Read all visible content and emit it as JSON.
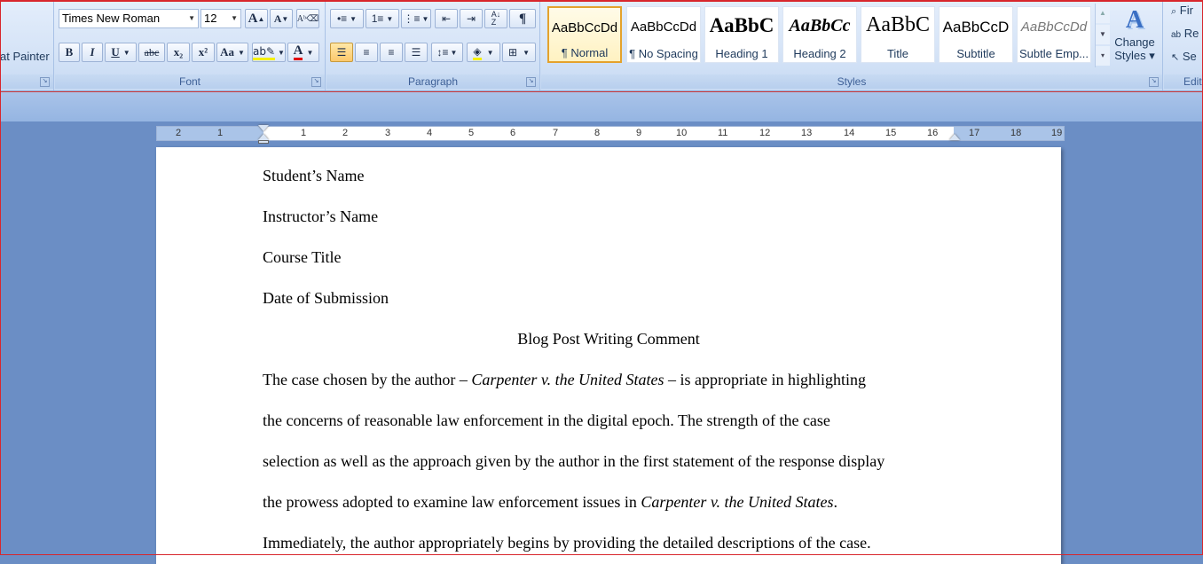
{
  "ribbon": {
    "clipboard": {
      "format_painter_label": "at Painter"
    },
    "font": {
      "label": "Font",
      "font_name": "Times New Roman",
      "font_size": "12",
      "grow_glyph": "A",
      "shrink_glyph": "A",
      "bold": "B",
      "italic": "I",
      "underline": "U",
      "strikethrough": "abc",
      "subscript": "x₂",
      "superscript": "x²",
      "change_case": "Aa",
      "font_color_glyph": "A"
    },
    "paragraph": {
      "label": "Paragraph",
      "pilcrow": "¶"
    },
    "styles": {
      "label": "Styles",
      "items": [
        {
          "sample": "AaBbCcDd",
          "name": "¶ Normal"
        },
        {
          "sample": "AaBbCcDd",
          "name": "¶ No Spacing"
        },
        {
          "sample": "AaBbC",
          "name": "Heading 1"
        },
        {
          "sample": "AaBbCc",
          "name": "Heading 2"
        },
        {
          "sample": "AaBbC",
          "name": "Title"
        },
        {
          "sample": "AaBbCcD",
          "name": "Subtitle"
        },
        {
          "sample": "AaBbCcDd",
          "name": "Subtle Emp..."
        }
      ],
      "change_styles_line1": "Change",
      "change_styles_line2": "Styles ▾"
    },
    "editing": {
      "label": "Editi",
      "find": "Fir",
      "replace": "Re",
      "select": "Se"
    }
  },
  "ruler": {
    "left_numbers": [
      "2",
      "1"
    ],
    "right_numbers": [
      "1",
      "2",
      "3",
      "4",
      "5",
      "6",
      "7",
      "8",
      "9",
      "10",
      "11",
      "12",
      "13",
      "14",
      "15",
      "16",
      "17",
      "18",
      "19"
    ]
  },
  "document": {
    "student_name": "Student’s Name",
    "instructor_name": "Instructor’s Name",
    "course_title": "Course Title",
    "date": "Date of Submission",
    "title": "Blog Post Writing Comment",
    "p1_a": "The case chosen by the author – ",
    "p1_case": "Carpenter v. the United States",
    "p1_b": " – is appropriate in highlighting",
    "p2": "the concerns of reasonable law enforcement in the digital epoch. The strength of the case",
    "p3": "selection as well as the approach given by the author in the first statement of the response display",
    "p4_a": "the prowess adopted to examine law enforcement issues in ",
    "p4_case": "Carpenter v. the United States",
    "p4_b": ".",
    "p5": "Immediately, the author appropriately begins by providing the detailed descriptions of the case."
  }
}
